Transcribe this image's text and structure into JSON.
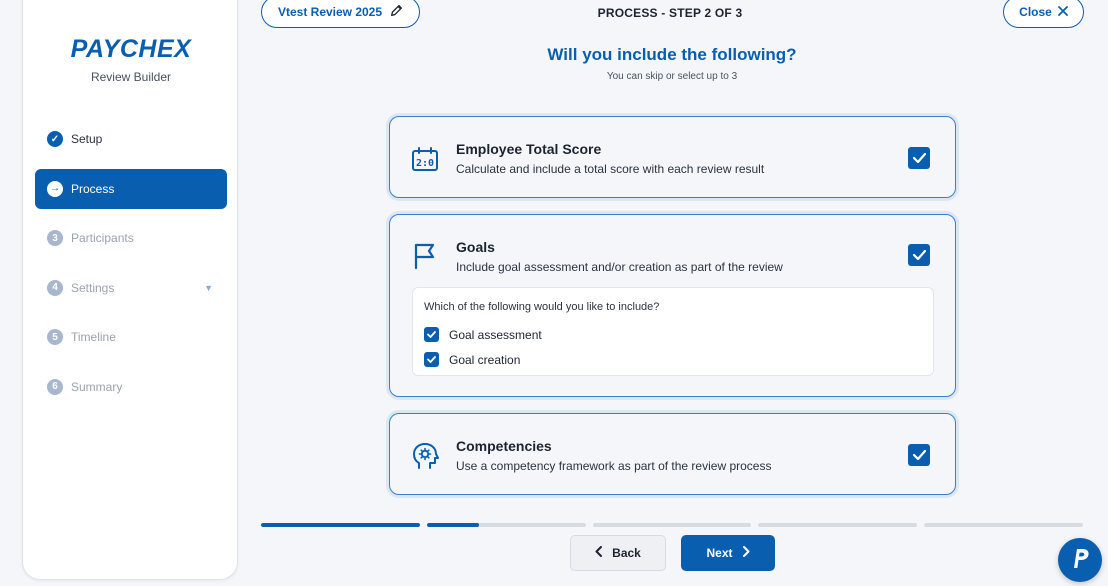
{
  "brand": {
    "logo_text": "PAYCHEX",
    "app_name": "Review Builder",
    "primary_color": "#0a5eb0"
  },
  "sidebar": {
    "items": [
      {
        "label": "Setup",
        "badge": "✓",
        "state": "completed"
      },
      {
        "label": "Process",
        "badge": "→",
        "state": "active"
      },
      {
        "label": "Participants",
        "badge": "3",
        "state": "disabled"
      },
      {
        "label": "Settings",
        "badge": "4",
        "state": "disabled",
        "has_dropdown": true
      },
      {
        "label": "Timeline",
        "badge": "5",
        "state": "disabled"
      },
      {
        "label": "Summary",
        "badge": "6",
        "state": "disabled"
      }
    ]
  },
  "header": {
    "review_name": "Vtest Review 2025",
    "step_label": "PROCESS - STEP 2 OF 3",
    "close_label": "Close"
  },
  "main": {
    "question": "Will you include the following?",
    "subtext": "You can skip or select up to 3",
    "options": [
      {
        "title": "Employee Total Score",
        "description": "Calculate and include a total score with each review result",
        "icon": "scoreboard-icon",
        "checked": true
      },
      {
        "title": "Goals",
        "description": "Include goal assessment and/or creation as part of the review",
        "icon": "flag-icon",
        "checked": true,
        "sub_question": "Which of the following would you like to include?",
        "sub_options": [
          {
            "label": "Goal assessment",
            "checked": true
          },
          {
            "label": "Goal creation",
            "checked": true
          }
        ]
      },
      {
        "title": "Competencies",
        "description": "Use a competency framework as part of the review process",
        "icon": "head-gear-icon",
        "checked": true
      }
    ]
  },
  "progress": {
    "segments": [
      1.0,
      0.33,
      0,
      0,
      0
    ]
  },
  "footer": {
    "back_label": "Back",
    "next_label": "Next"
  }
}
